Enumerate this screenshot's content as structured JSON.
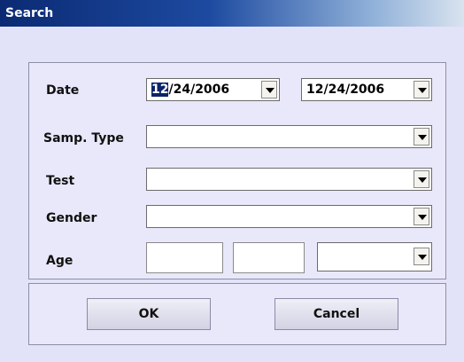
{
  "window": {
    "title": "Search"
  },
  "form": {
    "date": {
      "label": "Date",
      "from_prefix": "12",
      "from_rest": "/24/2006",
      "to_value": "12/24/2006"
    },
    "samp_type": {
      "label": "Samp. Type",
      "value": ""
    },
    "test": {
      "label": "Test",
      "value": ""
    },
    "gender": {
      "label": "Gender",
      "value": ""
    },
    "age": {
      "label": "Age",
      "from_value": "",
      "to_value": "",
      "unit_value": ""
    }
  },
  "buttons": {
    "ok_label": "OK",
    "cancel_label": "Cancel"
  },
  "icons": {
    "dropdown": "chevron-down-icon"
  }
}
